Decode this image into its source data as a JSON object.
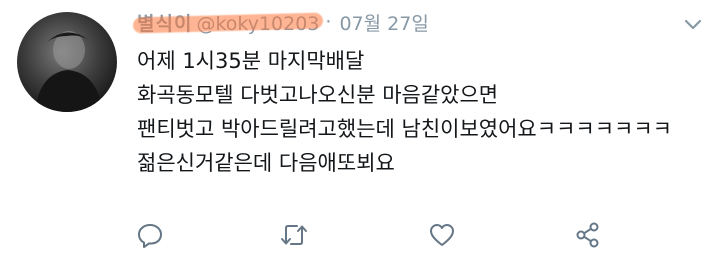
{
  "tweet": {
    "display_name": "별식이",
    "handle": "@koky10203",
    "separator": "·",
    "date": "07월 27일",
    "lines": [
      "어제 1시35분 마지막배달",
      "화곡동모텔 다벗고나오신분 마음같았으면",
      "팬티벗고 박아드릴려고했는데 남친이보였어요ㅋㅋㅋㅋㅋㅋㅋ",
      "젊은신거같은데 다음애또뵈요"
    ]
  },
  "icons": {
    "menu": "chevron-down-icon",
    "reply": "reply-icon",
    "retweet": "retweet-icon",
    "like": "heart-icon",
    "share": "share-icon"
  },
  "colors": {
    "meta_text": "#8899a6",
    "body_text": "#14171a",
    "redaction": "#ff7a3c"
  }
}
